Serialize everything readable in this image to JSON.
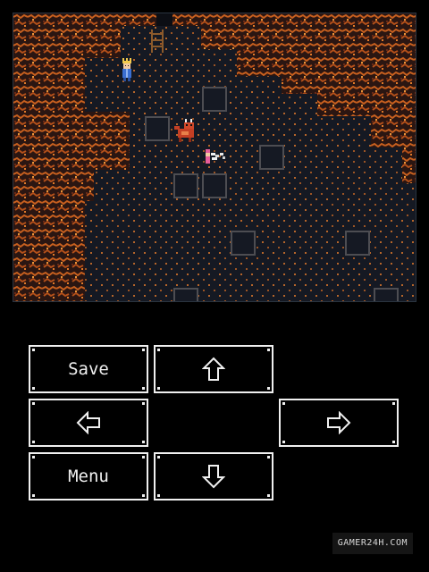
{
  "game": {
    "scene": "lava-cave",
    "colors": {
      "cave_floor": "#151923",
      "lava_rock": "#2b1612",
      "lava_vein": "#c8601f",
      "lava_ember": "#e9943a",
      "floor_speck": "#c8742c",
      "floor_tile_border": "#4d4d52",
      "ladder": "#8a5a2c"
    },
    "characters": [
      {
        "name": "hero-king",
        "description": "crowned hero in blue"
      },
      {
        "name": "red-dragon-whelp",
        "description": "small red horned creature"
      },
      {
        "name": "fairy-sprite",
        "description": "tiny pink fairy"
      }
    ]
  },
  "controls": {
    "save_label": "Save",
    "menu_label": "Menu",
    "up_icon": "arrow-up-icon",
    "down_icon": "arrow-down-icon",
    "left_icon": "arrow-left-icon",
    "right_icon": "arrow-right-icon"
  },
  "watermark": {
    "text": "GAMER24H.COM"
  }
}
